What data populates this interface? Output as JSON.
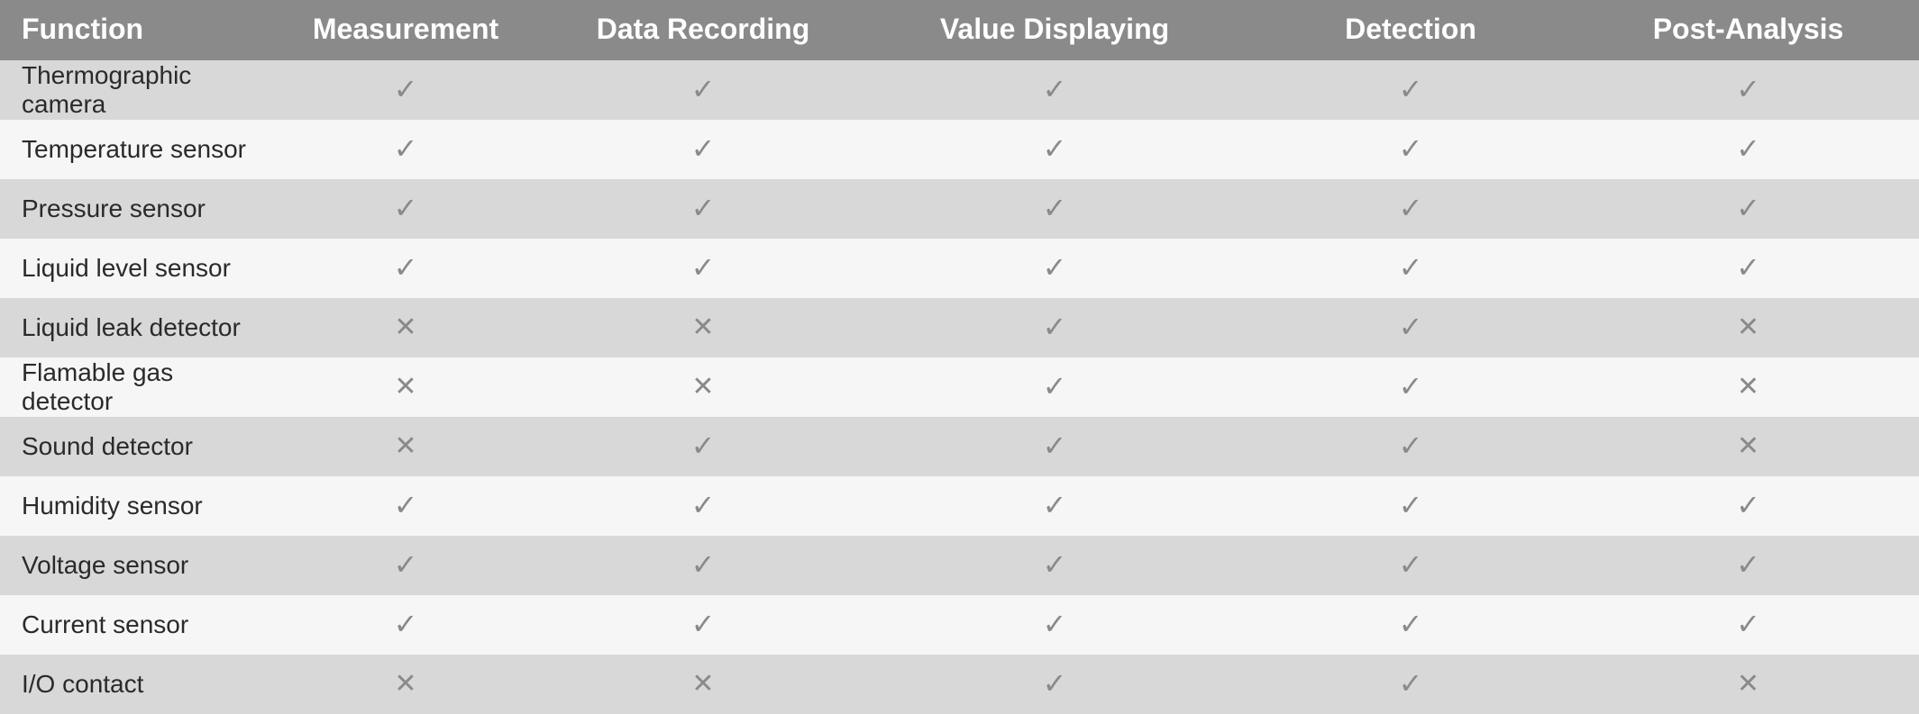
{
  "headers": {
    "function": "Function",
    "measurement": "Measurement",
    "recording": "Data Recording",
    "displaying": "Value Displaying",
    "detection": "Detection",
    "analysis": "Post-Analysis"
  },
  "glyphs": {
    "check": "✓",
    "cross": "✕"
  },
  "rows": [
    {
      "name": "Thermographic camera",
      "measurement": true,
      "recording": true,
      "displaying": true,
      "detection": true,
      "analysis": true
    },
    {
      "name": "Temperature sensor",
      "measurement": true,
      "recording": true,
      "displaying": true,
      "detection": true,
      "analysis": true
    },
    {
      "name": "Pressure sensor",
      "measurement": true,
      "recording": true,
      "displaying": true,
      "detection": true,
      "analysis": true
    },
    {
      "name": "Liquid level sensor",
      "measurement": true,
      "recording": true,
      "displaying": true,
      "detection": true,
      "analysis": true
    },
    {
      "name": "Liquid leak detector",
      "measurement": false,
      "recording": false,
      "displaying": true,
      "detection": true,
      "analysis": false
    },
    {
      "name": "Flamable gas detector",
      "measurement": false,
      "recording": false,
      "displaying": true,
      "detection": true,
      "analysis": false
    },
    {
      "name": "Sound detector",
      "measurement": false,
      "recording": true,
      "displaying": true,
      "detection": true,
      "analysis": false
    },
    {
      "name": "Humidity sensor",
      "measurement": true,
      "recording": true,
      "displaying": true,
      "detection": true,
      "analysis": true
    },
    {
      "name": "Voltage sensor",
      "measurement": true,
      "recording": true,
      "displaying": true,
      "detection": true,
      "analysis": true
    },
    {
      "name": "Current sensor",
      "measurement": true,
      "recording": true,
      "displaying": true,
      "detection": true,
      "analysis": true
    },
    {
      "name": "I/O contact",
      "measurement": false,
      "recording": false,
      "displaying": true,
      "detection": true,
      "analysis": false
    }
  ]
}
